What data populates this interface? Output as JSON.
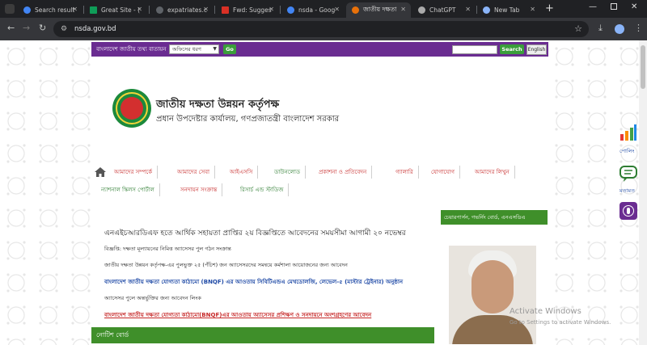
{
  "browser": {
    "tabs": [
      {
        "title": "Search result",
        "color": "#4285f4",
        "active": false
      },
      {
        "title": "Great Site - (",
        "color": "#0f9d58",
        "active": false
      },
      {
        "title": "expatriates.c",
        "color": "#5f6368",
        "active": false
      },
      {
        "title": "Fwd: Sugges",
        "color": "#d93025",
        "active": false
      },
      {
        "title": "nsda - Goog",
        "color": "#4285f4",
        "active": false
      },
      {
        "title": "জাতীয় দক্ষতা",
        "color": "#e8710a",
        "active": true
      },
      {
        "title": "ChatGPT",
        "color": "#aaaaaa",
        "active": false
      },
      {
        "title": "New Tab",
        "color": "#8ab4f8",
        "active": false
      }
    ],
    "url": "nsda.gov.bd"
  },
  "topbar": {
    "label": "বাংলাদেশ জাতীয় তথ্য বাতায়ন",
    "select_value": "অফিসের ধরণ",
    "go_label": "Go",
    "search_label": "Search",
    "english_label": "English"
  },
  "header": {
    "title": "জাতীয় দক্ষতা উন্নয়ন কর্তৃপক্ষ",
    "subtitle": "প্রধান উপদেষ্টার কার্যালয়, গণপ্রজাতন্ত্রী বাংলাদেশ সরকার"
  },
  "menu": {
    "row1": [
      "আমাদের সম্পর্কে",
      "আমাদের সেবা",
      "আইএসসি",
      "ডাউনলোড",
      "প্রকাশনা ও প্রতিবেদন",
      "গ্যালারি",
      "যোগাযোগ",
      "আমাদের লিখুন"
    ],
    "row2": [
      "ন্যাশনাল স্কিলস পোর্টাল",
      "সনদায়ন সংক্রান্ত",
      "রিসার্চ এন্ড স্টাডিজ"
    ]
  },
  "content": {
    "headline": "এনএইচআরডিএফ হতে আর্থিক সহায়তা প্রাপ্তির ২য় বিজ্ঞপ্তিতে আবেদনের সময়সীমা আগামী ২০ নভেম্বর",
    "line1": "বিজ্ঞপ্তি: দক্ষতা মূল্যায়নের নিমিত্ত অ্যাসেসর পুল গঠন সংক্রান্ত",
    "line2": "জাতীয় দক্ষতা উন্নয়ন কর্তৃপক্ষ-এর পুলভুক্ত ২৫ (পঁচিশ) জন অ্যাসেসরদের সমন্বয়ে কর্মশালা আয়োজনের জন্য আবেদন",
    "link_blue": "বাংলাদেশ জাতীয় দক্ষতা যোগ্যতা কাঠামো (BNQF) এর আওতায় সিবিটিএন্ডএ মেথডোলজি, লেভেল-৫ (মাস্টার ট্রেইনার) অনুষ্ঠান",
    "line3": "অ্যাসেসর পুলে অন্তর্ভুক্তির জন্য আবেদন লিংক",
    "link_red": "বাংলাদেশ জাতীয় দক্ষতা যোগ্যতা কাঠামো(BNQF)এর আওতায় অ্যাসেসর প্রশিক্ষণ ও সনদায়নে অংশগ্রহণের আবেদন",
    "notice": "নোটিশ বোর্ড"
  },
  "sidebar": {
    "heading": "চেয়ারপার্সন, গভর্নিং বোর্ড, এনএসডিএ"
  },
  "floating": {
    "poll_label": "পোলিং",
    "feedback_label": "মতামত"
  },
  "os_watermark": {
    "title": "Activate Windows",
    "subtitle": "Go to Settings to activate Windows."
  },
  "colors": {
    "purple": "#6a2c91",
    "green": "#3f8f2a",
    "menu_red": "#c62828",
    "menu_green": "#2e7d32"
  }
}
